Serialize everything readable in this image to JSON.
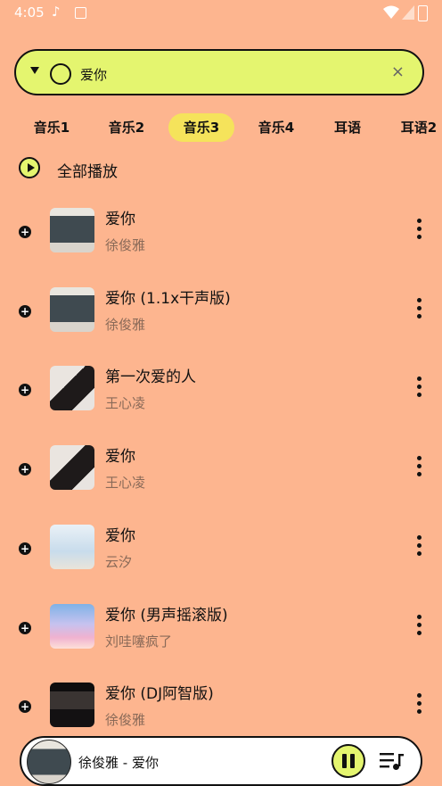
{
  "status_bar": {
    "time": "4:05"
  },
  "search": {
    "query": "爱你",
    "clear_icon": "×"
  },
  "tabs": [
    {
      "label": "音乐1",
      "active": false
    },
    {
      "label": "音乐2",
      "active": false
    },
    {
      "label": "音乐3",
      "active": true
    },
    {
      "label": "音乐4",
      "active": false
    },
    {
      "label": "耳语",
      "active": false
    },
    {
      "label": "耳语2",
      "active": false
    }
  ],
  "play_all": {
    "label": "全部播放"
  },
  "songs": [
    {
      "title": "爱你",
      "artist": "徐俊雅"
    },
    {
      "title": "爱你 (1.1x干声版)",
      "artist": "徐俊雅"
    },
    {
      "title": "第一次爱的人",
      "artist": "王心凌"
    },
    {
      "title": "爱你",
      "artist": "王心凌"
    },
    {
      "title": "爱你",
      "artist": "云汐"
    },
    {
      "title": "爱你 (男声摇滚版)",
      "artist": "刘哇噻疯了"
    },
    {
      "title": "爱你 (DJ阿智版)",
      "artist": "徐俊雅"
    }
  ],
  "player": {
    "now_playing": "徐俊雅 - 爱你"
  },
  "colors": {
    "background": "#fdb58f",
    "accent": "#e4f56f",
    "tab_active": "#f5e35b"
  }
}
